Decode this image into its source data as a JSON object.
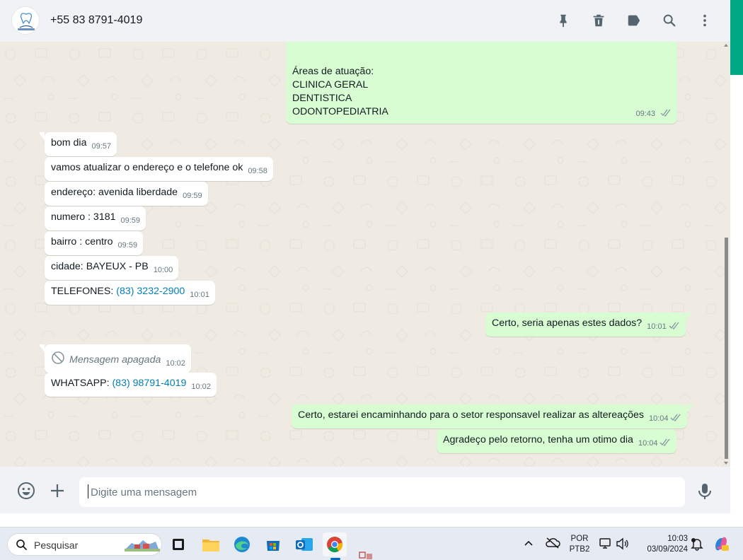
{
  "header": {
    "contact_name": "+55 83 8791-4019",
    "avatar_icon": "clinic-logo-icon",
    "icons": [
      "pin-icon",
      "trash-icon",
      "label-icon",
      "search-icon",
      "more-vertical-icon"
    ]
  },
  "messages": {
    "m0": {
      "lines": [
        "Áreas de atuação:",
        "CLINICA GERAL",
        "DENTISTICA",
        "ODONTOPEDIATRIA"
      ],
      "time": "09:43",
      "direction": "out",
      "status": "read"
    },
    "m1": {
      "text": "bom dia",
      "time": "09:57",
      "direction": "in"
    },
    "m2": {
      "text": "vamos atualizar o endereço e o telefone ok",
      "time": "09:58",
      "direction": "in"
    },
    "m3": {
      "text": "endereço: avenida liberdade",
      "time": "09:59",
      "direction": "in"
    },
    "m4": {
      "text": "numero : 3181",
      "time": "09:59",
      "direction": "in"
    },
    "m5": {
      "text": "bairro : centro",
      "time": "09:59",
      "direction": "in"
    },
    "m6": {
      "text": "cidade: BAYEUX - PB",
      "time": "10:00",
      "direction": "in"
    },
    "m7": {
      "prefix": "TELEFONES: ",
      "link": "(83) 3232-2900",
      "time": "10:01",
      "direction": "in"
    },
    "m8": {
      "text": "Certo, seria apenas estes dados?",
      "time": "10:01",
      "direction": "out",
      "status": "read"
    },
    "m9": {
      "text": "Mensagem apagada",
      "time": "10:02",
      "direction": "in",
      "deleted": true
    },
    "m10": {
      "prefix": "WHATSAPP: ",
      "link": "(83) 98791-4019",
      "time": "10:02",
      "direction": "in"
    },
    "m11": {
      "text": "Certo, estarei encaminhando para o setor responsavel realizar as altereações",
      "time": "10:04",
      "direction": "out",
      "status": "read"
    },
    "m12": {
      "text": "Agradeço pelo retorno, tenha um otimo dia",
      "time": "10:04",
      "direction": "out",
      "status": "read"
    }
  },
  "composer": {
    "placeholder": "Digite uma mensagem",
    "value": "",
    "icons": [
      "emoji-icon",
      "plus-icon",
      "microphone-icon"
    ]
  },
  "taskbar": {
    "search_placeholder": "Pesquisar",
    "apps": [
      "task-view-icon",
      "file-explorer-icon",
      "edge-icon",
      "microsoft-store-icon",
      "outlook-icon",
      "chrome-icon"
    ],
    "language": "POR",
    "keyboard": "PTB2",
    "time": "10:03",
    "date": "03/09/2024"
  },
  "colors": {
    "accent": "#00a884",
    "outgoing_bubble": "#d9fdd3",
    "incoming_bubble": "#ffffff",
    "chat_background": "#efeae2",
    "link": "#027eb5",
    "read_ticks": "#8696a0"
  }
}
